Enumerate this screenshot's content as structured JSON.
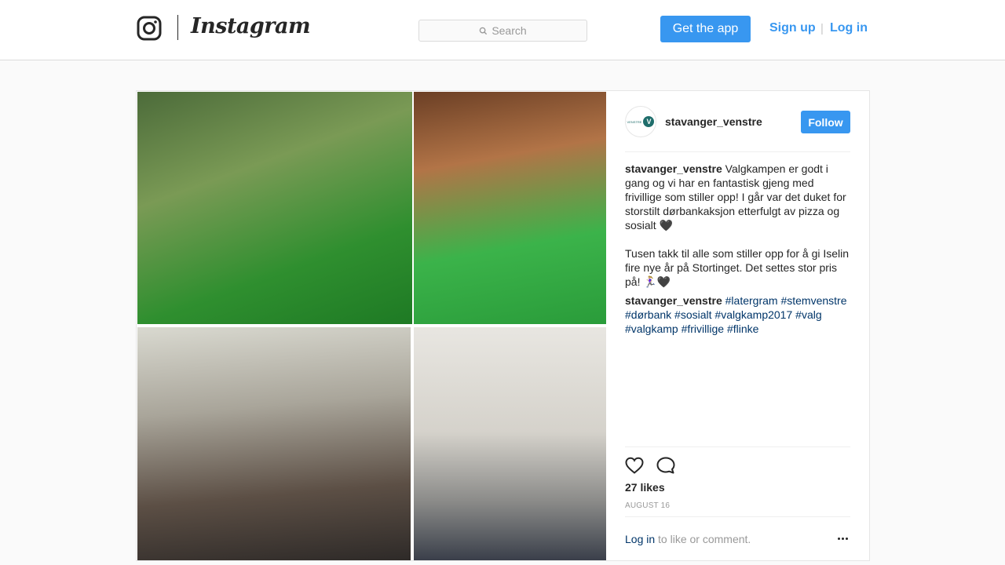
{
  "header": {
    "brand": "Instagram",
    "search_placeholder": "Search",
    "get_app": "Get the app",
    "sign_up": "Sign up",
    "separator": "|",
    "log_in": "Log in"
  },
  "post": {
    "username": "stavanger_venstre",
    "follow": "Follow",
    "caption_user": "stavanger_venstre",
    "caption_p1": "Valgkampen er godt i gang og vi har en fantastisk gjeng med frivillige som stiller opp! I går var det duket for storstilt dørbankaksjon etterfulgt av pizza og sosialt 🖤",
    "caption_p2": "Tusen takk til alle som stiller opp for å gi Iselin fire nye år på Stortinget. Det settes stor pris på! 🏃🏼‍♀️🖤",
    "comment_user": "stavanger_venstre",
    "hashtags": [
      "#latergram",
      "#stemvenstre",
      "#dørbank",
      "#sosialt",
      "#valgkamp2017",
      "#valg",
      "#valgkamp",
      "#frivillige",
      "#flinke"
    ],
    "likes": "27 likes",
    "date": "AUGUST 16",
    "login_link": "Log in",
    "login_rest": " to like or comment."
  },
  "colors": {
    "accent": "#3897f0",
    "hashtag": "#003569",
    "muted": "#999999"
  }
}
